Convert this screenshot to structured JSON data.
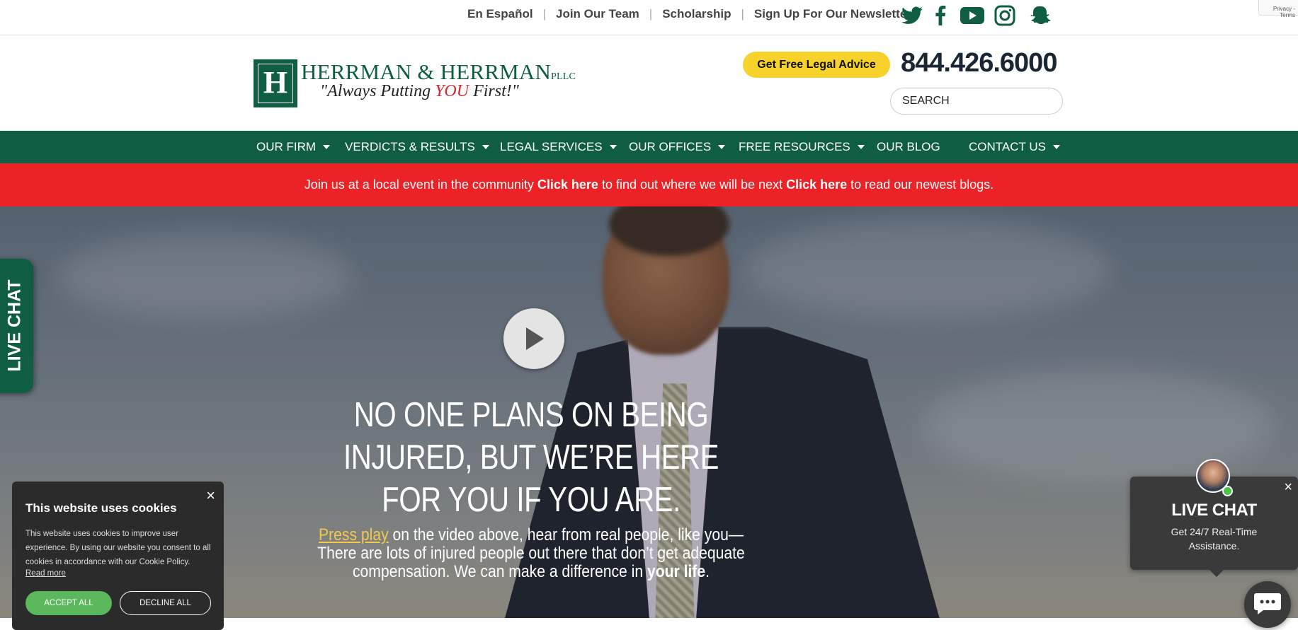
{
  "topbar": {
    "links": [
      "En Español",
      "Join Our Team",
      "Scholarship",
      "Sign Up For Our Newsletter"
    ],
    "social_icons": [
      "twitter-icon",
      "facebook-icon",
      "youtube-icon",
      "instagram-icon",
      "snapchat-icon"
    ],
    "recaptcha_text": "Privacy - Terms"
  },
  "header": {
    "logo_letter": "H",
    "firm_name": "HERRMAN & HERRMAN",
    "firm_suffix": "PLLC",
    "tagline_before": "\"Always Putting ",
    "tagline_you": "YOU",
    "tagline_after": " First!\"",
    "cta_label": "Get Free Legal Advice",
    "phone": "844.426.6000",
    "search_placeholder": "SEARCH"
  },
  "nav": {
    "items": [
      {
        "label": "OUR FIRM",
        "dropdown": true
      },
      {
        "label": "VERDICTS & RESULTS",
        "dropdown": true
      },
      {
        "label": "LEGAL SERVICES",
        "dropdown": true
      },
      {
        "label": "OUR OFFICES",
        "dropdown": true
      },
      {
        "label": "FREE RESOURCES",
        "dropdown": true
      },
      {
        "label": "OUR BLOG",
        "dropdown": false
      },
      {
        "label": "CONTACT US",
        "dropdown": true
      }
    ]
  },
  "announcement": {
    "part1": "Join us at a local event in the community ",
    "link1": "Click here",
    "part2": " to find out where we will be next ",
    "link2": "Click here",
    "part3": " to read our newest blogs."
  },
  "hero": {
    "headline": "NO ONE PLANS ON BEING INJURED, BUT WE’RE HERE FOR YOU IF YOU ARE.",
    "press_play": "Press play",
    "sub1": " on the video above, hear from real people, like you—",
    "sub2": "There are lots of injured people out there that don’t get adequate",
    "sub3": "compensation. We can make a difference in ",
    "sub_bold": "your life",
    "sub_end": "."
  },
  "side_chat": {
    "label": "LIVE CHAT"
  },
  "cookie": {
    "title": "This website uses cookies",
    "body": "This website uses cookies to improve user experience. By using our website you consent to all cookies in accordance with our Cookie Policy.",
    "read_more": "Read more",
    "accept": "ACCEPT ALL",
    "decline": "DECLINE ALL",
    "close": "×"
  },
  "chat_popup": {
    "title": "LIVE CHAT",
    "subtitle": "Get 24/7 Real-Time Assistance.",
    "close": "×"
  },
  "colors": {
    "brand_green": "#0f5e44",
    "announcement_red": "#ec2226",
    "cta_yellow": "#f7d22b",
    "accept_green": "#5cb85c"
  }
}
